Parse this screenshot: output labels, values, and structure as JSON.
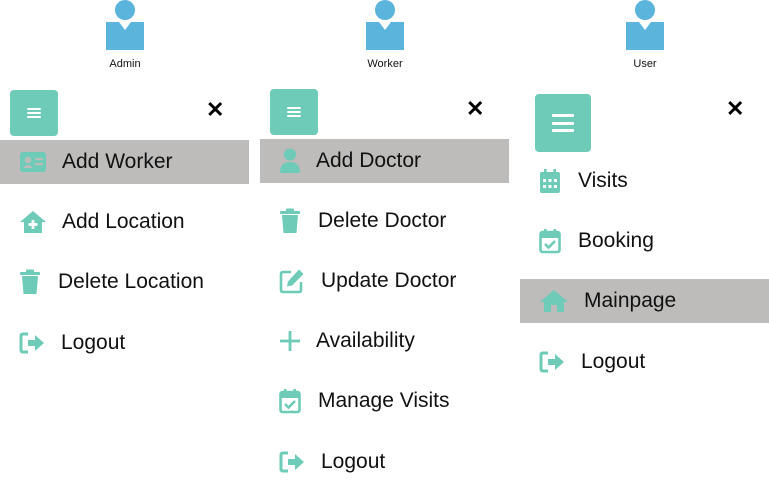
{
  "panels": [
    {
      "role": "Admin",
      "items": [
        {
          "label": "Add Worker",
          "icon": "id-card-icon",
          "active": true
        },
        {
          "label": "Add Location",
          "icon": "house-plus-icon",
          "active": false
        },
        {
          "label": "Delete Location",
          "icon": "trash-icon",
          "active": false
        },
        {
          "label": "Logout",
          "icon": "logout-icon",
          "active": false
        }
      ]
    },
    {
      "role": "Worker",
      "items": [
        {
          "label": "Add Doctor",
          "icon": "user-icon",
          "active": true
        },
        {
          "label": "Delete Doctor",
          "icon": "trash-icon",
          "active": false
        },
        {
          "label": "Update Doctor",
          "icon": "edit-icon",
          "active": false
        },
        {
          "label": "Availability",
          "icon": "plus-icon",
          "active": false
        },
        {
          "label": "Manage Visits",
          "icon": "calendar-check-icon",
          "active": false
        },
        {
          "label": "Logout",
          "icon": "logout-icon",
          "active": false
        }
      ]
    },
    {
      "role": "User",
      "items": [
        {
          "label": "Visits",
          "icon": "calendar-icon",
          "active": false
        },
        {
          "label": "Booking",
          "icon": "calendar-check-icon",
          "active": false
        },
        {
          "label": "Mainpage",
          "icon": "home-icon",
          "active": true
        },
        {
          "label": "Logout",
          "icon": "logout-icon",
          "active": false
        }
      ]
    }
  ],
  "close_symbol": "✕",
  "colors": {
    "accent": "#6dcbb8",
    "avatar": "#5ab4dc",
    "active_bg": "#bdbcbb"
  }
}
